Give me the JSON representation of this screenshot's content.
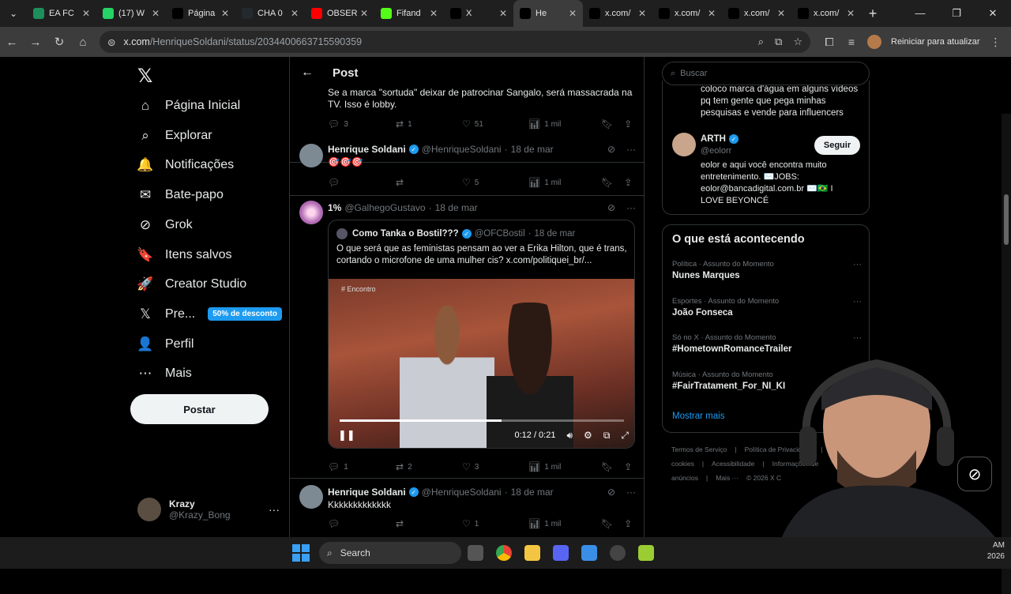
{
  "browser": {
    "tabs": [
      {
        "label": "EA FC",
        "icon": "ea-fc-icon",
        "color": "#1d8f5a"
      },
      {
        "label": "(17) W",
        "icon": "whatsapp-icon",
        "color": "#25d366"
      },
      {
        "label": "Página",
        "icon": "x-logo-icon",
        "color": "#000000"
      },
      {
        "label": "CHA 0",
        "icon": "github-icon",
        "color": "#24292e"
      },
      {
        "label": "OBSER",
        "icon": "youtube-icon",
        "color": "#ff0000"
      },
      {
        "label": "Fifand",
        "icon": "kick-icon",
        "color": "#53fc18"
      },
      {
        "label": "X",
        "icon": "x-logo-icon",
        "color": "#000000"
      },
      {
        "label": "He",
        "icon": "x-logo-icon",
        "color": "#000000"
      },
      {
        "label": "x.com/",
        "icon": "x-logo-icon",
        "color": "#000000"
      },
      {
        "label": "x.com/",
        "icon": "x-logo-icon",
        "color": "#000000"
      },
      {
        "label": "x.com/",
        "icon": "x-logo-icon",
        "color": "#000000"
      },
      {
        "label": "x.com/",
        "icon": "x-logo-icon",
        "color": "#000000"
      }
    ],
    "url_domain": "x.com",
    "url_path": "/HenriqueSoldani/status/2034400663715590359",
    "update_button": "Reiniciar para atualizar"
  },
  "nav": {
    "items": [
      {
        "label": "Página Inicial",
        "icon": "home-icon",
        "glyph": "⌂"
      },
      {
        "label": "Explorar",
        "icon": "search-icon",
        "glyph": "⌕"
      },
      {
        "label": "Notificações",
        "icon": "bell-icon",
        "glyph": "🔔"
      },
      {
        "label": "Bate-papo",
        "icon": "mail-icon",
        "glyph": "✉"
      },
      {
        "label": "Grok",
        "icon": "grok-icon",
        "glyph": "⊘"
      },
      {
        "label": "Itens salvos",
        "icon": "bookmark-icon",
        "glyph": "🔖"
      },
      {
        "label": "Creator Studio",
        "icon": "rocket-icon",
        "glyph": "🚀"
      },
      {
        "label": "Pre...",
        "icon": "x-premium-icon",
        "glyph": "𝕏"
      },
      {
        "label": "Perfil",
        "icon": "person-icon",
        "glyph": "👤"
      },
      {
        "label": "Mais",
        "icon": "more-circle-icon",
        "glyph": "⋯"
      }
    ],
    "premium_badge": "50% de desconto",
    "post_button": "Postar",
    "account": {
      "name": "Krazy",
      "handle": "@Krazy_Bong"
    }
  },
  "main": {
    "header_title": "Post",
    "top_reply": {
      "text": "Se a marca \"sortuda\" deixar de patrocinar Sangalo, será massacrada na TV. Isso é lobby.",
      "replies": "3",
      "reposts": "1",
      "likes": "51",
      "views": "1 mil"
    },
    "reply2": {
      "name": "Henrique Soldani",
      "handle": "@HenriqueSoldani",
      "date": "18 de mar",
      "text": "🎯🎯🎯",
      "replies": "",
      "reposts": "",
      "likes": "5",
      "views": "1 mil"
    },
    "reply3": {
      "name": "1%",
      "handle": "@GalhegoGustavo",
      "date": "18 de mar",
      "quote": {
        "name": "Como Tanka o Bostil???",
        "handle": "@OFCBostil",
        "date": "18 de mar",
        "text": "O que será que as feministas pensam ao ver a Erika Hilton, que é trans, cortando o microfone de uma mulher cis?  x.com/politiquei_br/...",
        "video_label": "# Encontro",
        "time": "0:12 / 0:21",
        "progress": 0.57
      },
      "replies": "1",
      "reposts": "2",
      "likes": "3",
      "views": "1 mil"
    },
    "reply4": {
      "name": "Henrique Soldani",
      "handle": "@HenriqueSoldani",
      "date": "18 de mar",
      "text": "Kkkkkkkkkkkkk",
      "replies": "",
      "reposts": "",
      "likes": "1",
      "views": "1 mil"
    }
  },
  "sidebar": {
    "search_placeholder": "Buscar",
    "prev_text": "coloco marca d'água em alguns vídeos pq tem gente que pega minhas pesquisas e vende para influencers",
    "suggest": {
      "name": "ARTH",
      "handle": "@eolorr",
      "follow": "Seguir",
      "bio": "eolor e aqui você encontra muito entretenimento. ✉️JOBS: eolor@bancadigital.com.br ✉️🇧🇷 I LOVE BEYONCÉ"
    },
    "trends_title": "O que está acontecendo",
    "trends": [
      {
        "context": "Política · Assunto do Momento",
        "name": "Nunes Marques"
      },
      {
        "context": "Esportes · Assunto do Momento",
        "name": "João Fonseca"
      },
      {
        "context": "Só no X · Assunto do Momento",
        "name": "#HometownRomanceTrailer"
      },
      {
        "context": "Música · Assunto do Momento",
        "name": "#FairTratament_For_NI_KI"
      }
    ],
    "show_more": "Mostrar mais",
    "footer": [
      "Termos de Serviço",
      "|",
      "Política de Privacidade",
      "|",
      "Política de cookies",
      "|",
      "Acessibilidade",
      "|",
      "Informações de anúncios",
      "|",
      "Mais ···",
      "© 2026 X C"
    ]
  },
  "taskbar": {
    "search": "Search",
    "time": "AM",
    "date": "2026"
  }
}
